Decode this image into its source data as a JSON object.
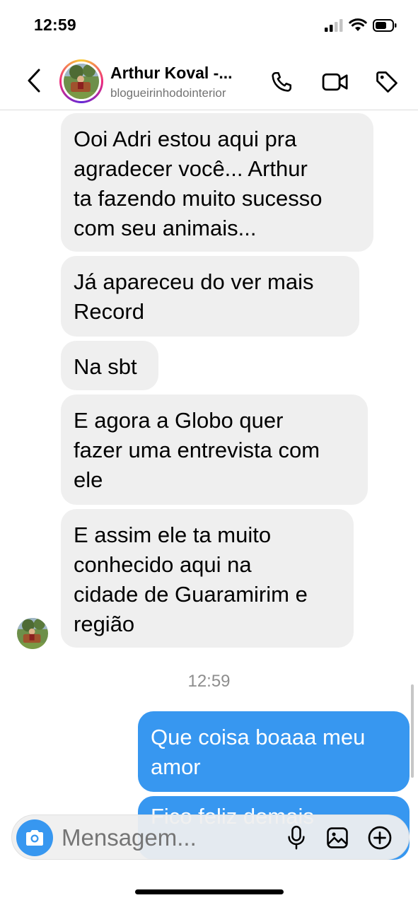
{
  "status_bar": {
    "time": "12:59"
  },
  "header": {
    "name": "Arthur Koval -...",
    "username": "blogueirinhodointerior"
  },
  "messages_in": [
    {
      "text": "Ooi Adri estou aqui pra\nagradecer você... Arthur\nta fazendo muito sucesso\ncom seu animais..."
    },
    {
      "text": "Já apareceu do ver mais\nRecord"
    },
    {
      "text": "Na sbt"
    },
    {
      "text": "E agora a Globo quer\nfazer uma entrevista com\nele"
    },
    {
      "text": "E assim ele ta muito\nconhecido aqui na\ncidade de Guaramirim e\nregião"
    }
  ],
  "timestamp": "12:59",
  "messages_out": [
    {
      "text": "Que coisa boaaa meu\namor"
    },
    {
      "text": "Fico feliz demais"
    }
  ],
  "composer": {
    "placeholder": "Mensagem..."
  },
  "colors": {
    "accent": "#3797f0",
    "incoming_bg": "#efefef",
    "outgoing_bg": "#3797f0"
  },
  "icons": [
    "back-chevron",
    "phone",
    "video-camera",
    "tag",
    "camera",
    "microphone",
    "gallery",
    "plus-circle"
  ]
}
